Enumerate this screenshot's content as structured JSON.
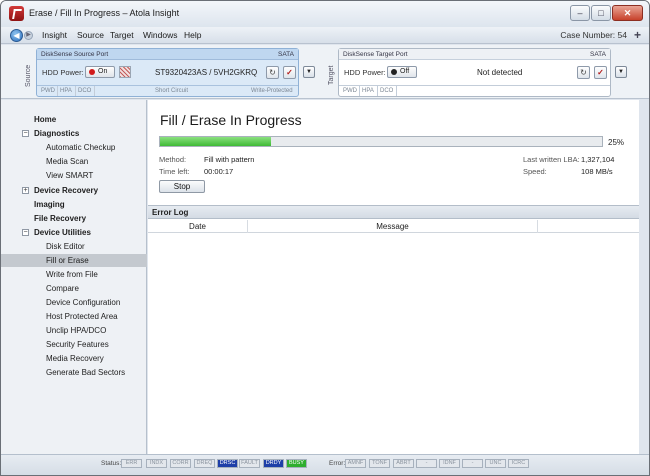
{
  "window": {
    "title": "Erase / Fill In Progress – Atola Insight"
  },
  "menu": {
    "items": [
      "Insight",
      "Source",
      "Target",
      "Windows",
      "Help"
    ],
    "case_number_label": "Case Number: 54"
  },
  "ports": {
    "source_side_label": "Source",
    "target_side_label": "Target",
    "source": {
      "header": "DiskSense Source Port",
      "interface": "SATA",
      "hdd_power_label": "HDD Power:",
      "power_state": "On",
      "power_color": "#d11a1a",
      "drive": "ST9320423AS / 5VH2GKRQ",
      "footer": {
        "pwd": "PWD",
        "hpa": "HPA",
        "dco": "DCO",
        "short": "Short Circuit",
        "wp": "Write-Protected"
      }
    },
    "target": {
      "header": "DiskSense Target Port",
      "interface": "SATA",
      "hdd_power_label": "HDD Power:",
      "power_state": "Off",
      "power_color": "#222222",
      "drive": "Not detected",
      "footer": {
        "pwd": "PWD",
        "hpa": "HPA",
        "dco": "DCO"
      }
    }
  },
  "nav": {
    "items": [
      {
        "label": "Home",
        "level": "top"
      },
      {
        "label": "Diagnostics",
        "level": "top",
        "expander": "−"
      },
      {
        "label": "Automatic Checkup",
        "level": "sub"
      },
      {
        "label": "Media Scan",
        "level": "sub"
      },
      {
        "label": "View SMART",
        "level": "sub"
      },
      {
        "label": "Device Recovery",
        "level": "top",
        "expander": "+"
      },
      {
        "label": "Imaging",
        "level": "top"
      },
      {
        "label": "File Recovery",
        "level": "top"
      },
      {
        "label": "Device Utilities",
        "level": "top",
        "expander": "−"
      },
      {
        "label": "Disk Editor",
        "level": "sub"
      },
      {
        "label": "Fill or Erase",
        "level": "sub",
        "selected": true
      },
      {
        "label": "Write from File",
        "level": "sub"
      },
      {
        "label": "Compare",
        "level": "sub"
      },
      {
        "label": "Device Configuration",
        "level": "sub"
      },
      {
        "label": "Host Protected Area",
        "level": "sub"
      },
      {
        "label": "Unclip HPA/DCO",
        "level": "sub"
      },
      {
        "label": "Security Features",
        "level": "sub"
      },
      {
        "label": "Media Recovery",
        "level": "sub"
      },
      {
        "label": "Generate Bad Sectors",
        "level": "sub"
      }
    ]
  },
  "main": {
    "title": "Fill / Erase In Progress",
    "progress_percent": 25,
    "progress_label": "25%",
    "method_label": "Method:",
    "method_value": "Fill with pattern",
    "time_left_label": "Time left:",
    "time_left_value": "00:00:17",
    "last_lba_label": "Last written LBA:",
    "last_lba_value": "1,327,104",
    "speed_label": "Speed:",
    "speed_value": "108 MB/s",
    "stop_label": "Stop"
  },
  "error_log": {
    "title": "Error Log",
    "columns": [
      "Date",
      "Message"
    ]
  },
  "statusbar": {
    "status_label": "Status:",
    "status_flags": [
      {
        "name": "ERR",
        "bg": "#e3e7ec",
        "fg": "#8a939e"
      },
      {
        "name": "INDX",
        "bg": "#e3e7ec",
        "fg": "#8a939e"
      },
      {
        "name": "CORR",
        "bg": "#e3e7ec",
        "fg": "#8a939e"
      },
      {
        "name": "DREQ",
        "bg": "#e3e7ec",
        "fg": "#8a939e"
      },
      {
        "name": "DRSC",
        "bg": "#1e3fa8",
        "fg": "#ffffff"
      },
      {
        "name": "FAULT",
        "bg": "#e3e7ec",
        "fg": "#8a939e"
      },
      {
        "name": "DRDY",
        "bg": "#1e3fa8",
        "fg": "#ffffff"
      },
      {
        "name": "BUSY",
        "bg": "#2fae2f",
        "fg": "#ffffff"
      }
    ],
    "error_label": "Error:",
    "error_flags": [
      "AMNF",
      "TONF",
      "ABRT",
      "-",
      "IDNF",
      "-",
      "UNC",
      "ICRC"
    ]
  }
}
